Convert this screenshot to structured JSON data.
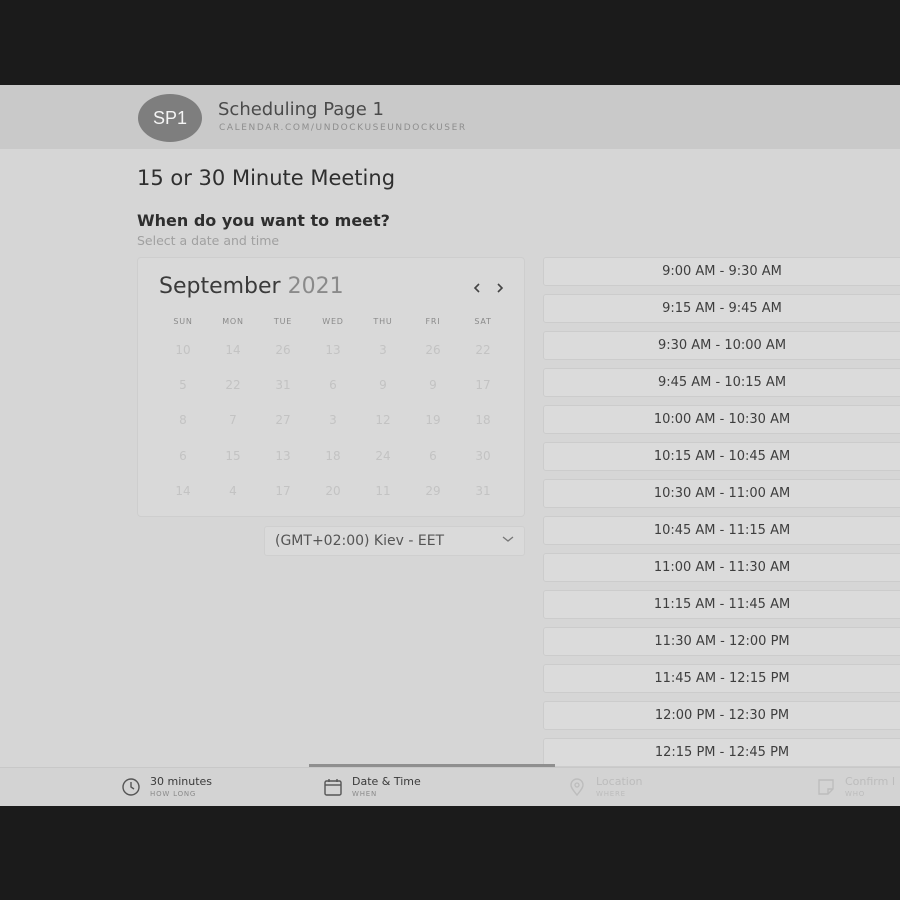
{
  "header": {
    "avatar_initials": "SP1",
    "page_name": "Scheduling Page 1",
    "page_url": "CALENDAR.COM/UNDOCKUSEUNDOCKUSER"
  },
  "meeting": {
    "title": "15 or 30 Minute Meeting",
    "question": "When do you want to meet?",
    "subtext": "Select a date and time"
  },
  "calendar": {
    "month": "September",
    "year": "2021",
    "weekdays": [
      "SUN",
      "MON",
      "TUE",
      "WED",
      "THU",
      "FRI",
      "SAT"
    ],
    "weeks": [
      [
        "10",
        "14",
        "26",
        "13",
        "3",
        "26",
        "22"
      ],
      [
        "5",
        "22",
        "31",
        "6",
        "9",
        "9",
        "17"
      ],
      [
        "8",
        "7",
        "27",
        "3",
        "12",
        "19",
        "18"
      ],
      [
        "6",
        "15",
        "13",
        "18",
        "24",
        "6",
        "30"
      ],
      [
        "14",
        "4",
        "17",
        "20",
        "11",
        "29",
        "31"
      ]
    ]
  },
  "timezone": {
    "value": "(GMT+02:00) Kiev - EET"
  },
  "time_slots": [
    "9:00 AM - 9:30 AM",
    "9:15 AM - 9:45 AM",
    "9:30 AM - 10:00 AM",
    "9:45 AM - 10:15 AM",
    "10:00 AM - 10:30 AM",
    "10:15 AM - 10:45 AM",
    "10:30 AM - 11:00 AM",
    "10:45 AM - 11:15 AM",
    "11:00 AM - 11:30 AM",
    "11:15 AM - 11:45 AM",
    "11:30 AM - 12:00 PM",
    "11:45 AM - 12:15 PM",
    "12:00 PM - 12:30 PM",
    "12:15 PM - 12:45 PM"
  ],
  "steps": {
    "duration": {
      "title": "30 minutes",
      "subtitle": "HOW LONG",
      "icon": "clock-icon"
    },
    "datetime": {
      "title": "Date & Time",
      "subtitle": "WHEN",
      "icon": "calendar-icon"
    },
    "location": {
      "title": "Location",
      "subtitle": "WHERE",
      "icon": "location-pin-icon"
    },
    "confirm": {
      "title": "Confirm I",
      "subtitle": "WHO",
      "icon": "confirm-icon"
    }
  },
  "colors": {
    "page_background": "#d6d6d6",
    "header_background": "#c9c9c9",
    "avatar": "#7e7e7e",
    "letterbox": "#1b1b1b"
  }
}
